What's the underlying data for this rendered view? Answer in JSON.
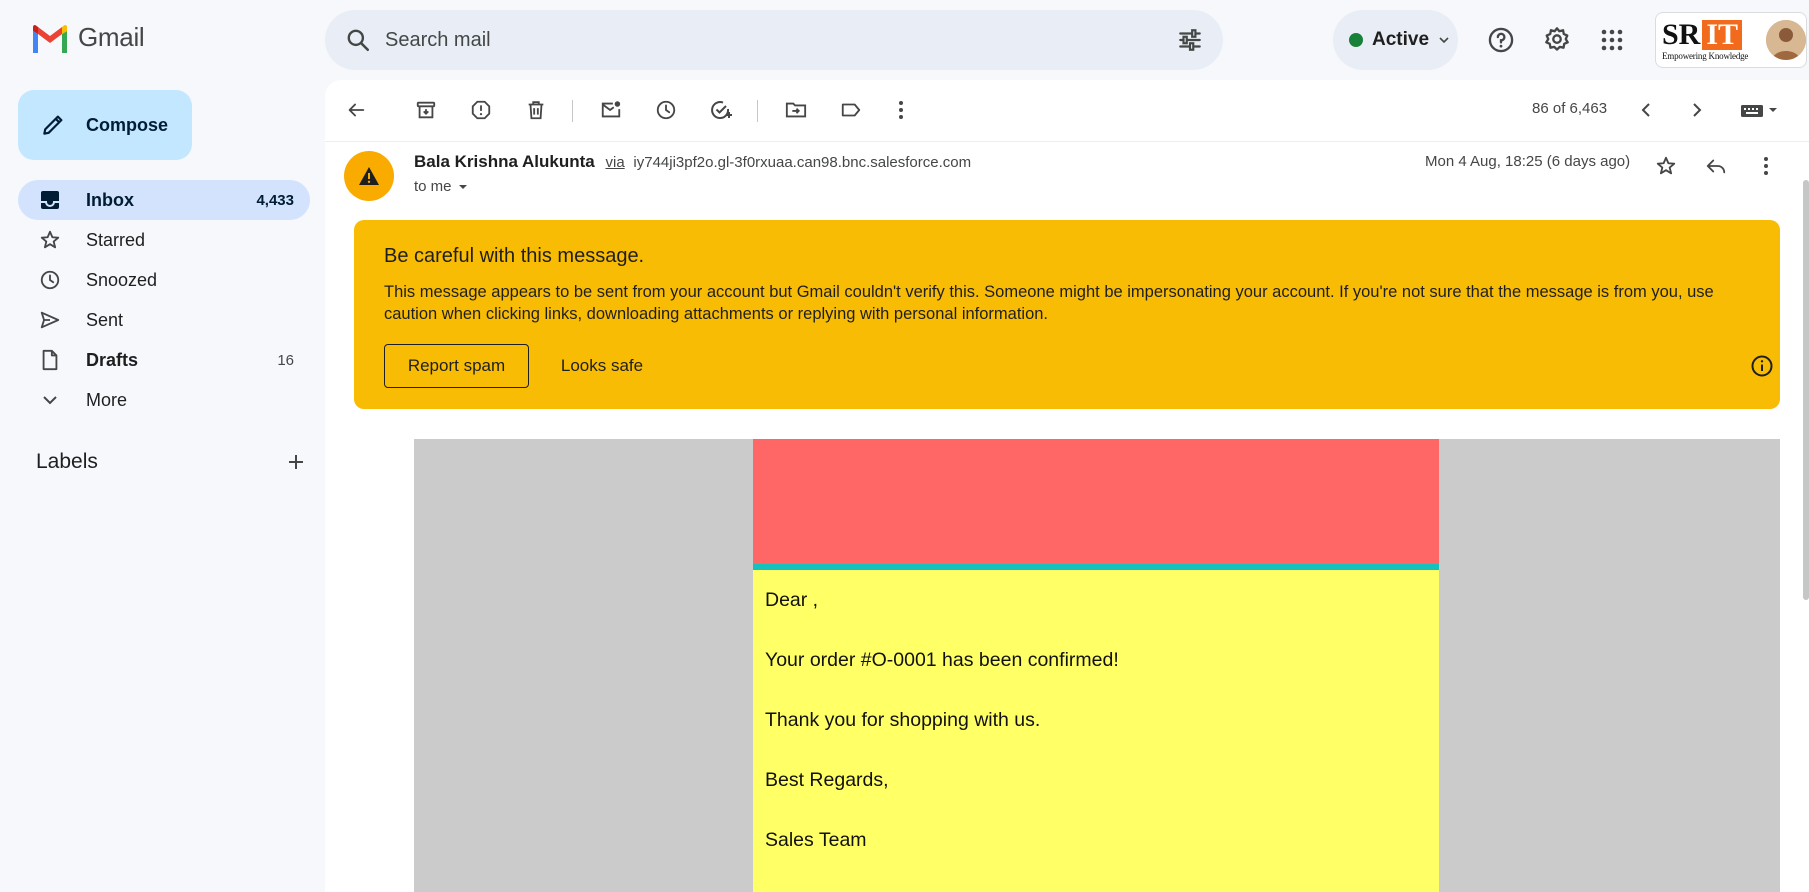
{
  "app": {
    "name": "Gmail",
    "accent": "#c2e7ff",
    "active_nav": "#d3e3fd"
  },
  "search": {
    "placeholder": "Search mail",
    "icon": "search-icon",
    "filter_icon": "tune-icon"
  },
  "header": {
    "status_label": "Active",
    "status_color": "#188038",
    "icons": [
      "help-icon",
      "gear-icon",
      "apps-grid-icon"
    ],
    "brand": {
      "sr": "SR",
      "it": "IT",
      "tagline": "Empowering Knowledge"
    }
  },
  "sidebar": {
    "compose_label": "Compose",
    "items": [
      {
        "label": "Inbox",
        "count": "4,433",
        "icon": "inbox-icon"
      },
      {
        "label": "Starred",
        "count": "",
        "icon": "star-icon"
      },
      {
        "label": "Snoozed",
        "count": "",
        "icon": "clock-icon"
      },
      {
        "label": "Sent",
        "count": "",
        "icon": "send-icon"
      },
      {
        "label": "Drafts",
        "count": "16",
        "icon": "draft-icon"
      },
      {
        "label": "More",
        "count": "",
        "icon": "chevron-down-icon"
      }
    ],
    "labels_title": "Labels"
  },
  "toolbar": {
    "pager": "86 of 6,463",
    "icons": [
      "back-arrow-icon",
      "archive-icon",
      "report-spam-icon",
      "delete-icon",
      "mark-unread-icon",
      "snooze-icon",
      "add-task-icon",
      "move-to-icon",
      "label-icon",
      "more-vert-icon",
      "prev-icon",
      "next-icon",
      "keyboard-icon"
    ]
  },
  "message": {
    "sender_name": "Bala Krishna Alukunta",
    "via": "via",
    "via_domain": "iy744ji3pf2o.gl-3f0rxuaa.can98.bnc.salesforce.com",
    "to": "to me",
    "date": "Mon 4 Aug, 18:25 (6 days ago)"
  },
  "warning": {
    "title": "Be careful with this message.",
    "body": "This message appears to be sent from your account but Gmail couldn't verify this. Someone might be impersonating your account. If you're not sure that the message is from you, use caution when clicking links, downloading attachments or replying with personal information.",
    "report_label": "Report spam",
    "safe_label": "Looks safe",
    "color": "#f9bc05"
  },
  "email": {
    "banner_color": "#ff6666",
    "divider_color": "#13c2bc",
    "content_color": "#ffff66",
    "lines": [
      "Dear ,",
      "Your order #O-0001 has been confirmed!",
      "Thank you for shopping with us.",
      "Best Regards,",
      "Sales Team"
    ]
  }
}
